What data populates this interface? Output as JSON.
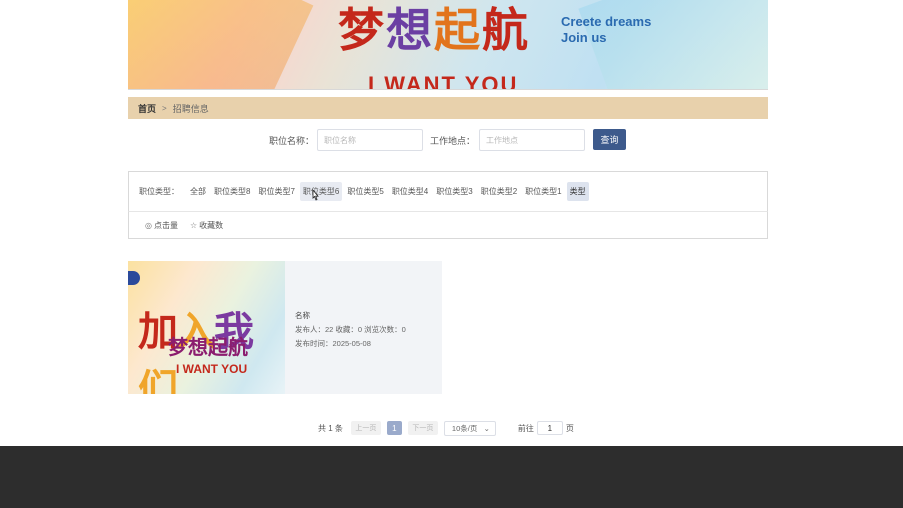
{
  "banner": {
    "slogan_cn": [
      "梦",
      "想",
      "起",
      "航"
    ],
    "slogan_en_line1": "Creete dreams",
    "slogan_en_line2": "Join us",
    "slogan_big": "I WANT YOU"
  },
  "breadcrumb": {
    "home": "首页",
    "separator": ">",
    "current": "招聘信息"
  },
  "search": {
    "job_name_label": "职位名称：",
    "job_name_placeholder": "职位名称",
    "location_label": "工作地点：",
    "location_placeholder": "工作地点",
    "query_button": "查询"
  },
  "filter": {
    "label": "职位类型：",
    "items": [
      {
        "label": "全部",
        "state": "normal"
      },
      {
        "label": "职位类型8",
        "state": "normal"
      },
      {
        "label": "职位类型7",
        "state": "normal"
      },
      {
        "label": "职位类型6",
        "state": "hover"
      },
      {
        "label": "职位类型5",
        "state": "normal"
      },
      {
        "label": "职位类型4",
        "state": "normal"
      },
      {
        "label": "职位类型3",
        "state": "normal"
      },
      {
        "label": "职位类型2",
        "state": "normal"
      },
      {
        "label": "职位类型1",
        "state": "normal"
      },
      {
        "label": "类型",
        "state": "active"
      }
    ]
  },
  "sort": {
    "clicks_label": "点击量",
    "favorites_label": "收藏数",
    "clicks_icon": "eye-icon",
    "favorites_icon": "star-icon"
  },
  "cards": [
    {
      "image_text_1": [
        "加",
        "入",
        "我",
        "们"
      ],
      "image_text_2": "梦想起航",
      "image_text_3": "I WANT YOU",
      "name": "名称",
      "stats": "发布人：22  收藏：0  浏览次数：0",
      "date": "发布时间：2025-05-08"
    }
  ],
  "pagination": {
    "total": "共 1 条",
    "prev": "上一页",
    "current_page": "1",
    "next": "下一页",
    "page_size": "10条/页",
    "goto_label": "前往",
    "goto_value": "1",
    "page_suffix": "页"
  },
  "colors": {
    "breadcrumb_bg": "#e8d1ac",
    "primary_button": "#3d5a8c",
    "footer_bg": "#2d2d2d"
  }
}
